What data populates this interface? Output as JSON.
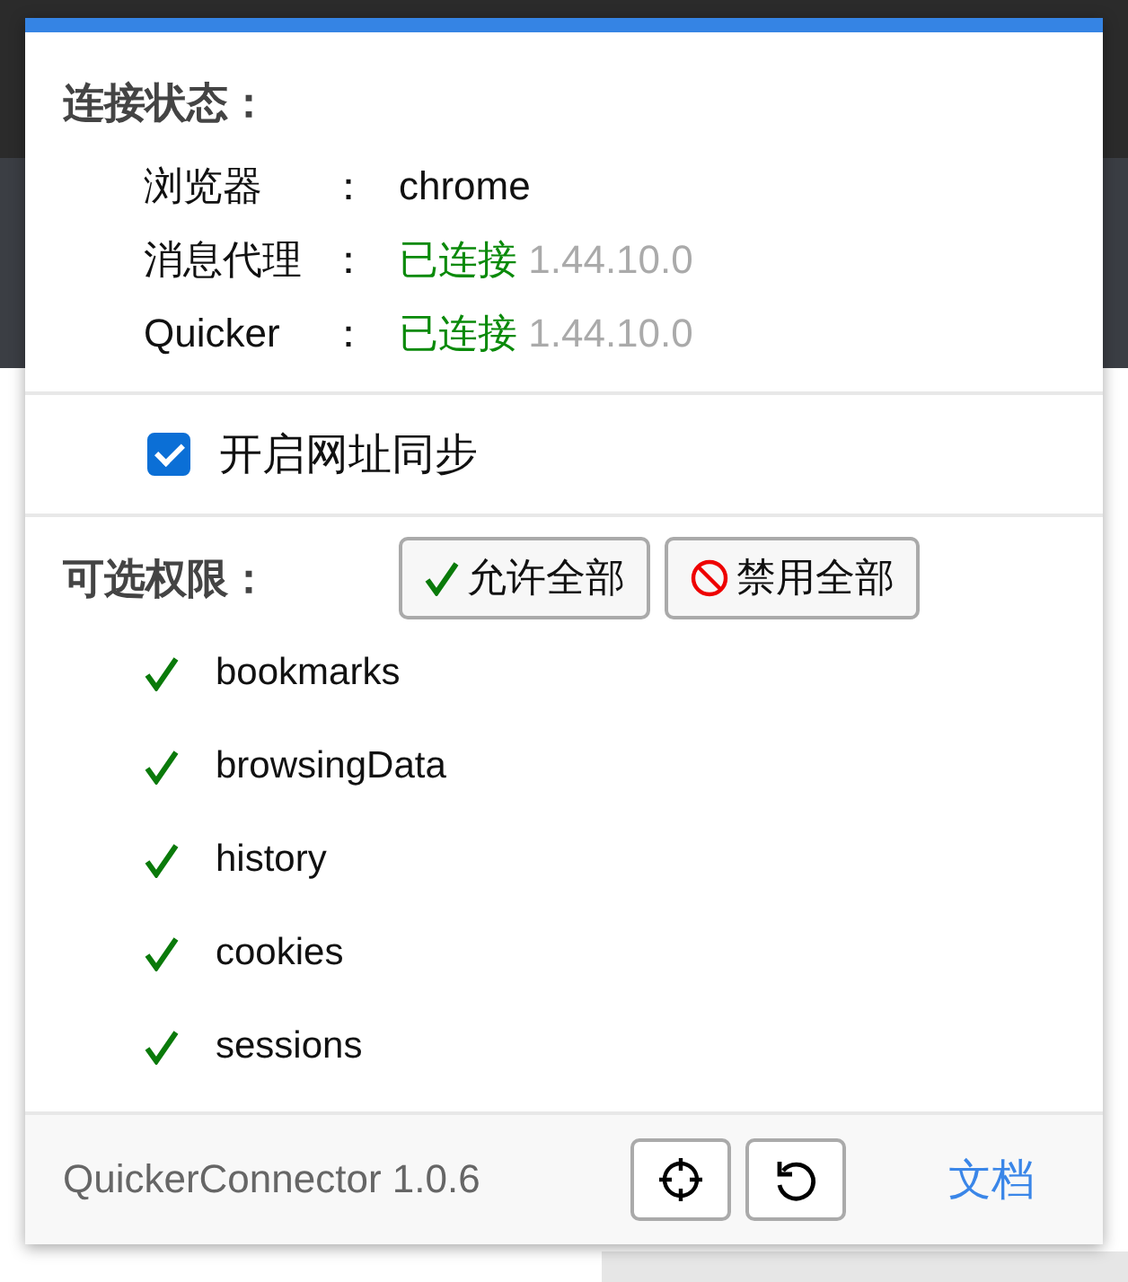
{
  "connection": {
    "title": "连接状态：",
    "rows": [
      {
        "kind": "text",
        "label": "浏览器",
        "separator": "：",
        "value": "chrome"
      },
      {
        "kind": "status",
        "label": "消息代理",
        "separator": "：",
        "connected": true,
        "status": "已连接",
        "version": "1.44.10.0"
      },
      {
        "kind": "status",
        "label": "Quicker",
        "separator": "：",
        "connected": true,
        "status": "已连接",
        "version": "1.44.10.0"
      }
    ]
  },
  "sync": {
    "label": "开启网址同步",
    "checked": true
  },
  "permissions": {
    "title": "可选权限：",
    "buttons": [
      {
        "kind": "allow",
        "label": "允许全部"
      },
      {
        "kind": "deny",
        "label": "禁用全部"
      }
    ],
    "items": [
      {
        "name": "bookmarks",
        "granted": true
      },
      {
        "name": "browsingData",
        "granted": true
      },
      {
        "name": "history",
        "granted": true
      },
      {
        "name": "cookies",
        "granted": true
      },
      {
        "name": "sessions",
        "granted": true
      }
    ]
  },
  "footer": {
    "version": "QuickerConnector 1.0.6",
    "buttons": [
      {
        "kind": "locate"
      },
      {
        "kind": "reset"
      }
    ],
    "link": "文档"
  }
}
